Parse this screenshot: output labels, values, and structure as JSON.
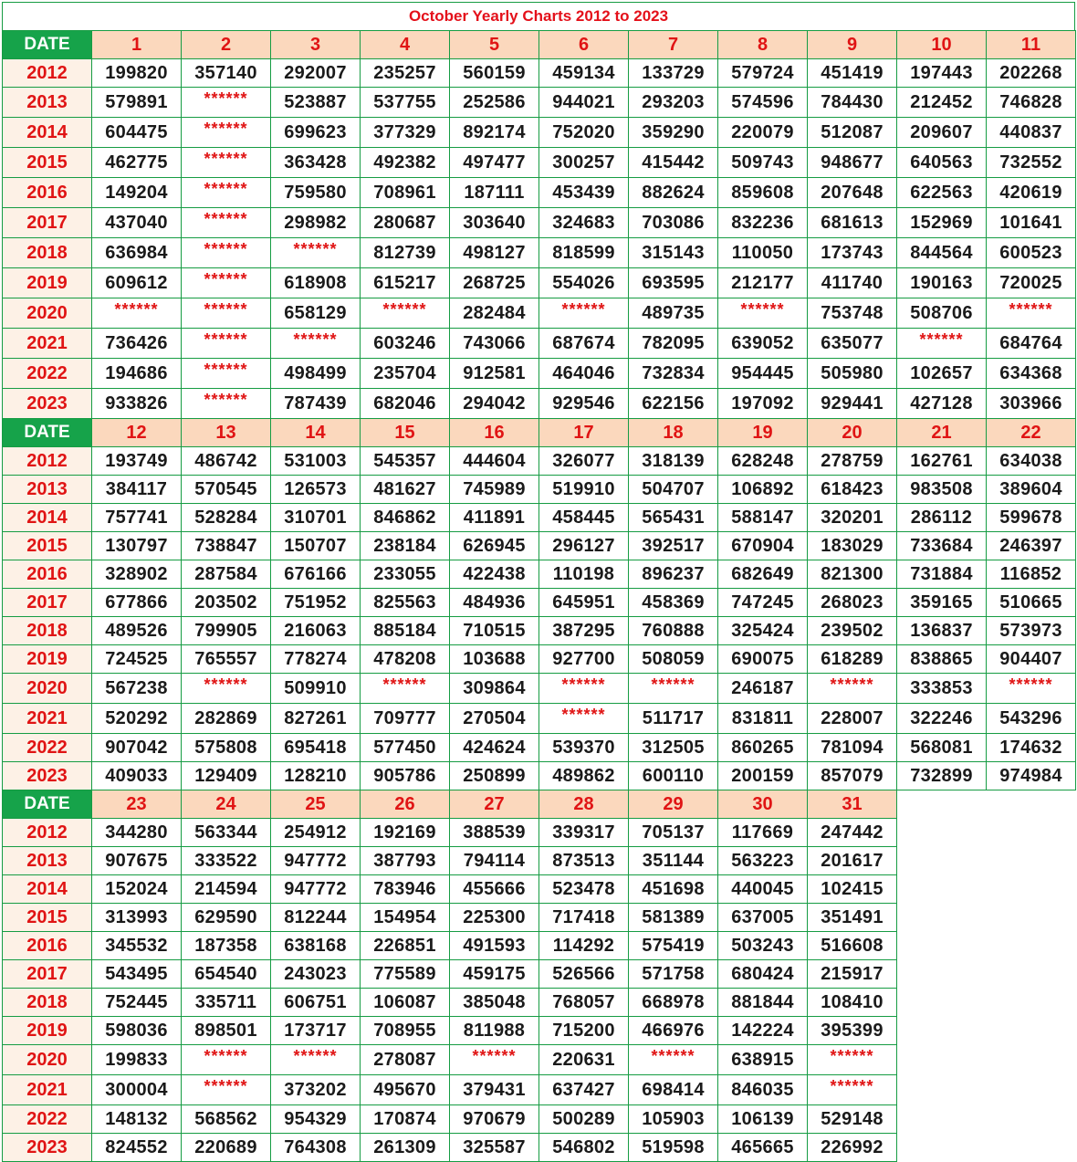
{
  "title": "October Yearly Charts 2012 to 2023",
  "date_label": "DATE",
  "colors": {
    "border": "#169c43",
    "date_bg": "#16a34a",
    "day_header_bg": "#fbd8bd",
    "year_bg": "#fdf1e6",
    "accent_red": "#e01414"
  },
  "years": [
    "2012",
    "2013",
    "2014",
    "2015",
    "2016",
    "2017",
    "2018",
    "2019",
    "2020",
    "2021",
    "2022",
    "2023"
  ],
  "blocks": [
    {
      "days": [
        "1",
        "2",
        "3",
        "4",
        "5",
        "6",
        "7",
        "8",
        "9",
        "10",
        "11"
      ],
      "rows": [
        [
          "199820",
          "357140",
          "292007",
          "235257",
          "560159",
          "459134",
          "133729",
          "579724",
          "451419",
          "197443",
          "202268"
        ],
        [
          "579891",
          "******",
          "523887",
          "537755",
          "252586",
          "944021",
          "293203",
          "574596",
          "784430",
          "212452",
          "746828"
        ],
        [
          "604475",
          "******",
          "699623",
          "377329",
          "892174",
          "752020",
          "359290",
          "220079",
          "512087",
          "209607",
          "440837"
        ],
        [
          "462775",
          "******",
          "363428",
          "492382",
          "497477",
          "300257",
          "415442",
          "509743",
          "948677",
          "640563",
          "732552"
        ],
        [
          "149204",
          "******",
          "759580",
          "708961",
          "187111",
          "453439",
          "882624",
          "859608",
          "207648",
          "622563",
          "420619"
        ],
        [
          "437040",
          "******",
          "298982",
          "280687",
          "303640",
          "324683",
          "703086",
          "832236",
          "681613",
          "152969",
          "101641"
        ],
        [
          "636984",
          "******",
          "******",
          "812739",
          "498127",
          "818599",
          "315143",
          "110050",
          "173743",
          "844564",
          "600523"
        ],
        [
          "609612",
          "******",
          "618908",
          "615217",
          "268725",
          "554026",
          "693595",
          "212177",
          "411740",
          "190163",
          "720025"
        ],
        [
          "******",
          "******",
          "658129",
          "******",
          "282484",
          "******",
          "489735",
          "******",
          "753748",
          "508706",
          "******"
        ],
        [
          "736426",
          "******",
          "******",
          "603246",
          "743066",
          "687674",
          "782095",
          "639052",
          "635077",
          "******",
          "684764"
        ],
        [
          "194686",
          "******",
          "498499",
          "235704",
          "912581",
          "464046",
          "732834",
          "954445",
          "505980",
          "102657",
          "634368"
        ],
        [
          "933826",
          "******",
          "787439",
          "682046",
          "294042",
          "929546",
          "622156",
          "197092",
          "929441",
          "427128",
          "303966"
        ]
      ]
    },
    {
      "days": [
        "12",
        "13",
        "14",
        "15",
        "16",
        "17",
        "18",
        "19",
        "20",
        "21",
        "22"
      ],
      "rows": [
        [
          "193749",
          "486742",
          "531003",
          "545357",
          "444604",
          "326077",
          "318139",
          "628248",
          "278759",
          "162761",
          "634038"
        ],
        [
          "384117",
          "570545",
          "126573",
          "481627",
          "745989",
          "519910",
          "504707",
          "106892",
          "618423",
          "983508",
          "389604"
        ],
        [
          "757741",
          "528284",
          "310701",
          "846862",
          "411891",
          "458445",
          "565431",
          "588147",
          "320201",
          "286112",
          "599678"
        ],
        [
          "130797",
          "738847",
          "150707",
          "238184",
          "626945",
          "296127",
          "392517",
          "670904",
          "183029",
          "733684",
          "246397"
        ],
        [
          "328902",
          "287584",
          "676166",
          "233055",
          "422438",
          "110198",
          "896237",
          "682649",
          "821300",
          "731884",
          "116852"
        ],
        [
          "677866",
          "203502",
          "751952",
          "825563",
          "484936",
          "645951",
          "458369",
          "747245",
          "268023",
          "359165",
          "510665"
        ],
        [
          "489526",
          "799905",
          "216063",
          "885184",
          "710515",
          "387295",
          "760888",
          "325424",
          "239502",
          "136837",
          "573973"
        ],
        [
          "724525",
          "765557",
          "778274",
          "478208",
          "103688",
          "927700",
          "508059",
          "690075",
          "618289",
          "838865",
          "904407"
        ],
        [
          "567238",
          "******",
          "509910",
          "******",
          "309864",
          "******",
          "******",
          "246187",
          "******",
          "333853",
          "******"
        ],
        [
          "520292",
          "282869",
          "827261",
          "709777",
          "270504",
          "******",
          "511717",
          "831811",
          "228007",
          "322246",
          "543296"
        ],
        [
          "907042",
          "575808",
          "695418",
          "577450",
          "424624",
          "539370",
          "312505",
          "860265",
          "781094",
          "568081",
          "174632"
        ],
        [
          "409033",
          "129409",
          "128210",
          "905786",
          "250899",
          "489862",
          "600110",
          "200159",
          "857079",
          "732899",
          "974984"
        ]
      ]
    },
    {
      "days": [
        "23",
        "24",
        "25",
        "26",
        "27",
        "28",
        "29",
        "30",
        "31"
      ],
      "rows": [
        [
          "344280",
          "563344",
          "254912",
          "192169",
          "388539",
          "339317",
          "705137",
          "117669",
          "247442"
        ],
        [
          "907675",
          "333522",
          "947772",
          "387793",
          "794114",
          "873513",
          "351144",
          "563223",
          "201617"
        ],
        [
          "152024",
          "214594",
          "947772",
          "783946",
          "455666",
          "523478",
          "451698",
          "440045",
          "102415"
        ],
        [
          "313993",
          "629590",
          "812244",
          "154954",
          "225300",
          "717418",
          "581389",
          "637005",
          "351491"
        ],
        [
          "345532",
          "187358",
          "638168",
          "226851",
          "491593",
          "114292",
          "575419",
          "503243",
          "516608"
        ],
        [
          "543495",
          "654540",
          "243023",
          "775589",
          "459175",
          "526566",
          "571758",
          "680424",
          "215917"
        ],
        [
          "752445",
          "335711",
          "606751",
          "106087",
          "385048",
          "768057",
          "668978",
          "881844",
          "108410"
        ],
        [
          "598036",
          "898501",
          "173717",
          "708955",
          "811988",
          "715200",
          "466976",
          "142224",
          "395399"
        ],
        [
          "199833",
          "******",
          "******",
          "278087",
          "******",
          "220631",
          "******",
          "638915",
          "******"
        ],
        [
          "300004",
          "******",
          "373202",
          "495670",
          "379431",
          "637427",
          "698414",
          "846035",
          "******"
        ],
        [
          "148132",
          "568562",
          "954329",
          "170874",
          "970679",
          "500289",
          "105903",
          "106139",
          "529148"
        ],
        [
          "824552",
          "220689",
          "764308",
          "261309",
          "325587",
          "546802",
          "519598",
          "465665",
          "226992"
        ]
      ]
    }
  ]
}
